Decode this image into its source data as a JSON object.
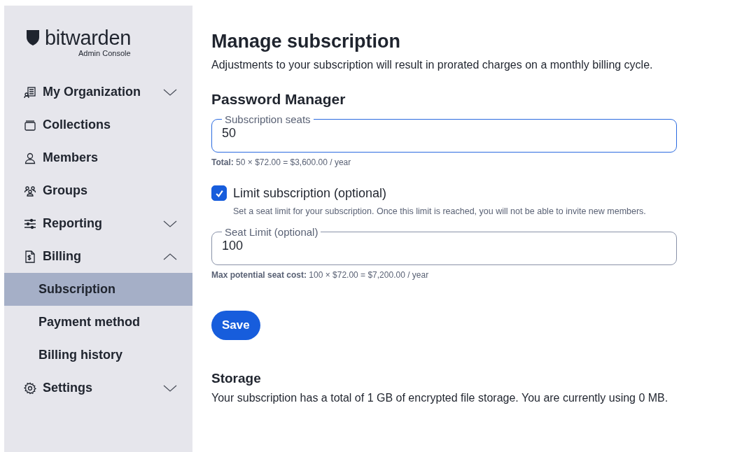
{
  "logo": {
    "wordmark": "**bit**warden",
    "subtitle": "Admin Console"
  },
  "sidebar": {
    "items": [
      {
        "label": "My Organization",
        "expanded": false,
        "selected": false
      },
      {
        "label": "Collections",
        "selected": false
      },
      {
        "label": "Members",
        "selected": false
      },
      {
        "label": "Groups",
        "selected": false
      },
      {
        "label": "Reporting",
        "expanded": false,
        "selected": false
      },
      {
        "label": "Billing",
        "expanded": true,
        "selected": false,
        "children": [
          {
            "label": "Subscription",
            "selected": true
          },
          {
            "label": "Payment method",
            "selected": false
          },
          {
            "label": "Billing history",
            "selected": false
          }
        ]
      },
      {
        "label": "Settings",
        "expanded": false,
        "selected": false
      }
    ]
  },
  "main": {
    "title": "Manage subscription",
    "description": "Adjustments to your subscription will result in prorated charges on a monthly billing cycle.",
    "section_title": "Password Manager",
    "seats_field": {
      "label": "Subscription seats",
      "value": "50",
      "focused": true
    },
    "seats_total": "**Total:** 50 × $72.00 = $3,600.00 / year",
    "limit_checkbox": {
      "label": "Limit subscription (optional)",
      "checked": true,
      "hint": "Set a seat limit for your subscription. Once this limit is reached, you will not be able to invite new members."
    },
    "limit_field": {
      "label": "Seat Limit (optional)",
      "value": "100",
      "focused": false
    },
    "limit_total": "**Max potential seat cost:** 100 × $72.00 = $7,200.00 / year",
    "save_button": "Save",
    "storage": {
      "title": "Storage",
      "text": "Your subscription has a total of 1 GB of encrypted file storage. You are currently using 0 MB."
    }
  }
}
